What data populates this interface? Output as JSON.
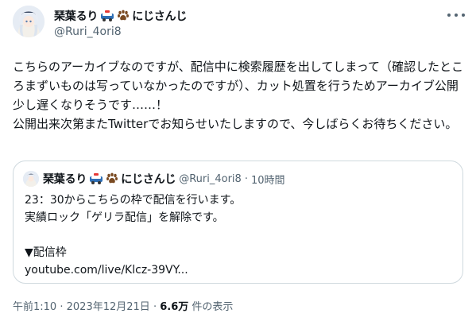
{
  "author": {
    "display_name": "琹葉るり",
    "suffix": "にじさんじ",
    "handle": "@Ruri_4ori8",
    "icons": [
      "police-car-icon",
      "paw-print-icon"
    ]
  },
  "tweet": {
    "paragraphs": [
      "こちらのアーカイブなのですが、配信中に検索履歴を出してしまって（確認したところまずいものは写っていなかったのですが）、カット処置を行うためアーカイブ公開少し遅くなりそうです……！",
      "公開出来次第またTwitterでお知らせいたしますので、今しばらくお待ちください。"
    ]
  },
  "quote": {
    "display_name": "琹葉るり",
    "suffix": "にじさんじ",
    "handle": "@Ruri_4ori8",
    "separator": "·",
    "time_ago": "10時間",
    "lines": [
      "23：30からこちらの枠で配信を行います。",
      "実績ロック「ゲリラ配信」を解除です。",
      "",
      "▼配信枠",
      "youtube.com/live/Klcz-39VY..."
    ]
  },
  "footer": {
    "time": "午前1:10",
    "separator": "·",
    "date": "2023年12月21日",
    "separator2": "·",
    "views_count": "6.6万",
    "views_label": "件の表示"
  },
  "colors": {
    "text": "#0f1419",
    "secondary": "#536471",
    "border": "#cfd9de",
    "paw": "#7a4a22",
    "car": "#2f6fb5"
  }
}
